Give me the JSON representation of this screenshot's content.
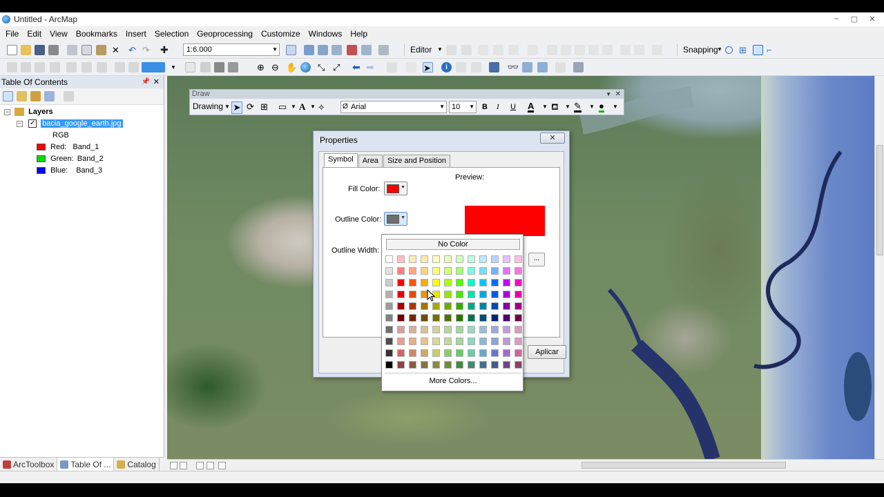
{
  "window": {
    "title": "Untitled - ArcMap",
    "controls": [
      "–",
      "▢",
      "✕"
    ]
  },
  "menu": [
    "File",
    "Edit",
    "View",
    "Bookmarks",
    "Insert",
    "Selection",
    "Geoprocessing",
    "Customize",
    "Windows",
    "Help"
  ],
  "toolbar": {
    "scale": "1:6.000",
    "editor_label": "Editor",
    "snapping_label": "Snapping"
  },
  "toc": {
    "title": "Table Of Contents",
    "layers_label": "Layers",
    "layer_name": "bacia_google_earth.jpg",
    "rgb_label": "RGB",
    "bands": [
      {
        "channel": "Red:",
        "band": "Band_1",
        "color": "#ff0000"
      },
      {
        "channel": "Green:",
        "band": "Band_2",
        "color": "#00dd00"
      },
      {
        "channel": "Blue:",
        "band": "Band_3",
        "color": "#0000ff"
      }
    ]
  },
  "bottom_tabs": [
    "ArcToolbox",
    "Table Of ...",
    "Catalog"
  ],
  "draw_toolbar": {
    "title": "Draw",
    "drawing_label": "Drawing",
    "font": "Arial",
    "size": "10",
    "bold": "B",
    "italic": "I",
    "underline": "U",
    "text_icon": "A"
  },
  "properties": {
    "title": "Properties",
    "close": "✕",
    "tabs": [
      "Symbol",
      "Area",
      "Size and Position"
    ],
    "preview_label": "Preview:",
    "fill_color_label": "Fill Color:",
    "outline_color_label": "Outline Color:",
    "outline_width_label": "Outline Width:",
    "fill_color": "#ff0000",
    "outline_color": "#6e6e6e",
    "apply_label": "Aplicar"
  },
  "palette": {
    "no_color_label": "No Color",
    "more_colors_label": "More Colors...",
    "rows": [
      [
        "#ffffff",
        "#ffbebe",
        "#ffebbe",
        "#ffebaf",
        "#ffffbe",
        "#e9ffbe",
        "#d3ffbe",
        "#beffe8",
        "#bee8ff",
        "#bed2ff",
        "#e8beff",
        "#ffbee8"
      ],
      [
        "#e1e1e1",
        "#ff7f7f",
        "#ffa77f",
        "#ffd37f",
        "#ffff73",
        "#d1ff73",
        "#a3ff73",
        "#73ffdf",
        "#73dfff",
        "#73b2ff",
        "#df73ff",
        "#ff73df"
      ],
      [
        "#cccccc",
        "#ff0000",
        "#ff5500",
        "#ffaa00",
        "#ffff00",
        "#aaff00",
        "#55ff00",
        "#00ffc5",
        "#00c5ff",
        "#0070ff",
        "#c500ff",
        "#ff00c5"
      ],
      [
        "#b2b2b2",
        "#e60000",
        "#e64c00",
        "#e69800",
        "#e6e600",
        "#98e600",
        "#4ce600",
        "#00e6a9",
        "#00a9e6",
        "#005ce6",
        "#a900e6",
        "#e600a9"
      ],
      [
        "#9c9c9c",
        "#a80000",
        "#a83800",
        "#a87000",
        "#a8a800",
        "#70a800",
        "#38a800",
        "#00a884",
        "#0084a8",
        "#004da8",
        "#8400a8",
        "#a80084"
      ],
      [
        "#828282",
        "#730000",
        "#732600",
        "#734c00",
        "#737300",
        "#4c7300",
        "#267300",
        "#00734c",
        "#004c73",
        "#002673",
        "#4c0073",
        "#73004c"
      ],
      [
        "#6e6e6e",
        "#d79e9e",
        "#d7b09e",
        "#d7c29e",
        "#d1d1a4",
        "#b4d79e",
        "#a3d79e",
        "#9ed7c2",
        "#9ebbd7",
        "#9eaad7",
        "#c29ed7",
        "#d69dbc"
      ],
      [
        "#4e4e4e",
        "#e69e8c",
        "#e6b08c",
        "#e6c28c",
        "#d7d79e",
        "#c2d79e",
        "#a3d79e",
        "#8cd7c2",
        "#8cb8d7",
        "#8ca4d7",
        "#b89ed7",
        "#d79ec2"
      ],
      [
        "#343434",
        "#cd6666",
        "#cd8966",
        "#cdaa66",
        "#cdcd66",
        "#89cd66",
        "#66cd66",
        "#66cdab",
        "#66a9cd",
        "#6677cd",
        "#ab66cd",
        "#cd6699"
      ],
      [
        "#000000",
        "#894444",
        "#895a44",
        "#897044",
        "#898944",
        "#708944",
        "#448944",
        "#448970",
        "#447089",
        "#445a89",
        "#704489",
        "#894465"
      ]
    ]
  }
}
